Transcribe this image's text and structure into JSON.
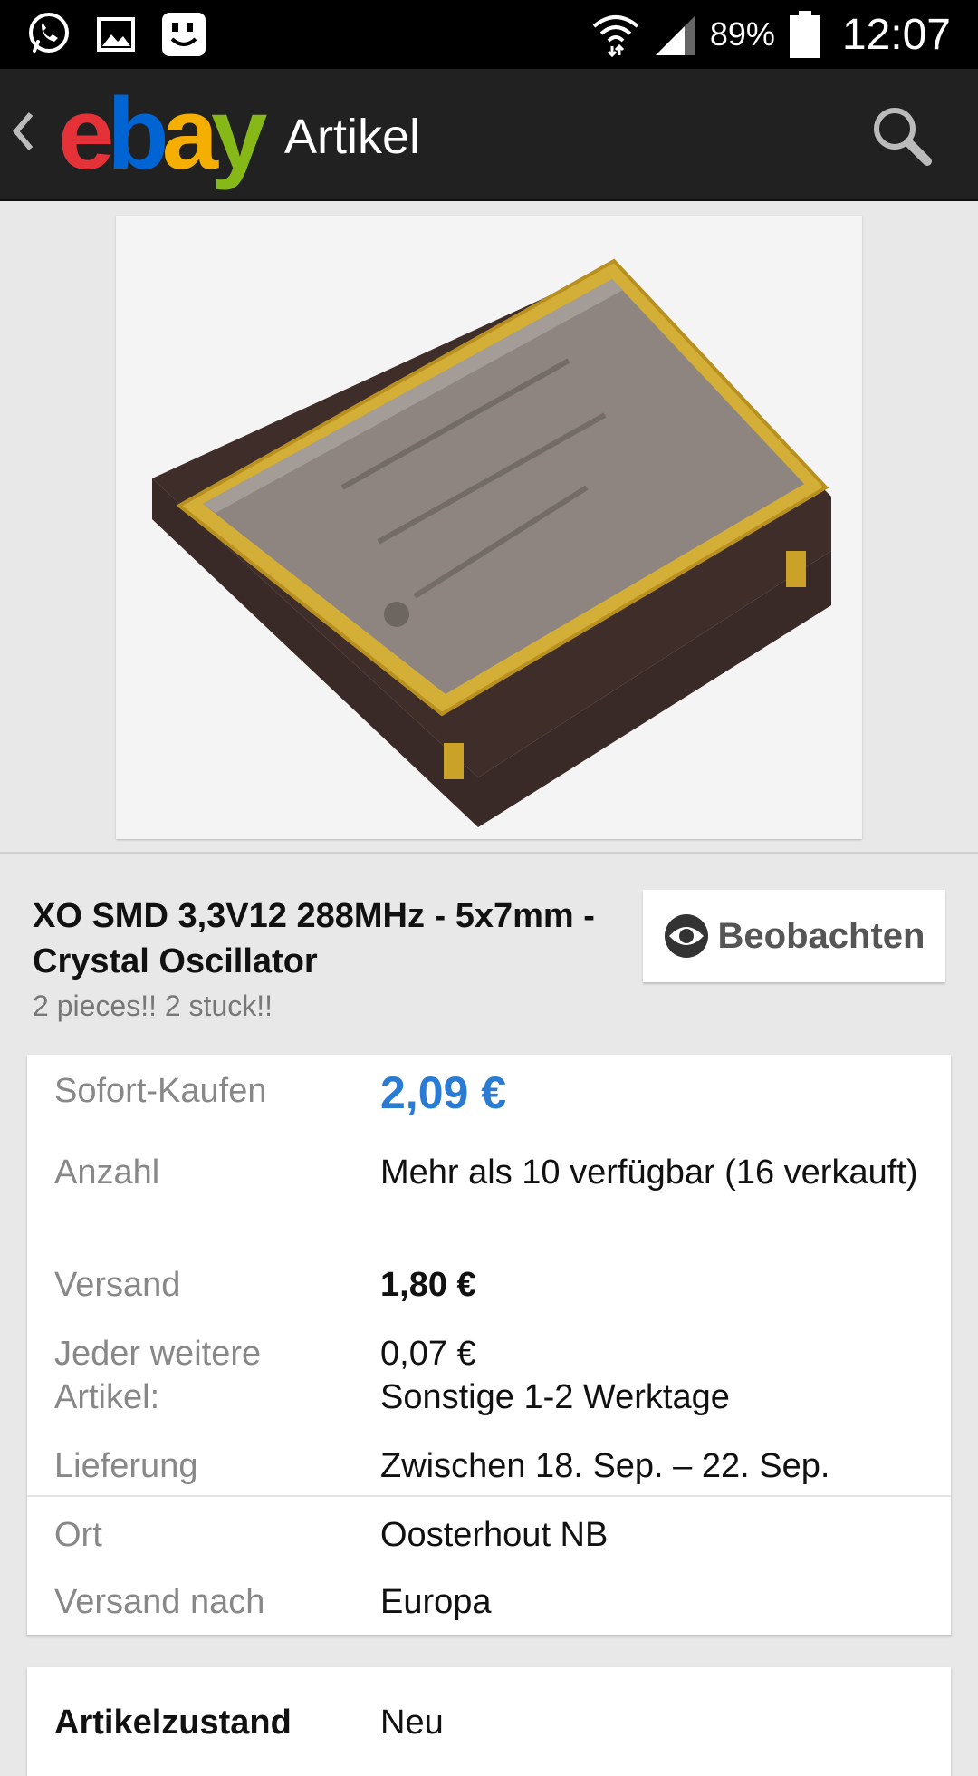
{
  "status_bar": {
    "battery_percent": "89%",
    "time": "12:07",
    "icons": [
      "whatsapp-icon",
      "gallery-icon",
      "messenger-icon",
      "wifi-icon",
      "signal-icon",
      "battery-icon"
    ]
  },
  "app_bar": {
    "logo": {
      "e": "e",
      "b": "b",
      "a": "a",
      "y": "y"
    },
    "title": "Artikel",
    "icons": [
      "back-chevron-icon",
      "search-icon"
    ]
  },
  "product": {
    "title": "XO SMD 3,3V12 288MHz - 5x7mm - Crystal Oscillator",
    "subtitle": "2 pieces!! 2 stuck!!",
    "watch_label": "Beobachten"
  },
  "details": {
    "buy_now_label": "Sofort-Kaufen",
    "buy_now_price": "2,09 €",
    "quantity_label": "Anzahl",
    "quantity_value": "Mehr als 10 verfügbar (16 verkauft)",
    "shipping_label": "Versand",
    "shipping_value": "1,80 €",
    "additional_label": "Jeder weitere Artikel:",
    "additional_value_price": "0,07 €",
    "additional_value_service": "Sonstige 1-2 Werktage",
    "delivery_label": "Lieferung",
    "delivery_value": "Zwischen 18. Sep. – 22. Sep.",
    "location_label": "Ort",
    "location_value": "Oosterhout NB",
    "ships_to_label": "Versand nach",
    "ships_to_value": "Europa"
  },
  "condition": {
    "label": "Artikelzustand",
    "value": "Neu"
  },
  "colors": {
    "price_blue": "#2a7bd4",
    "ebay_red": "#e53238",
    "ebay_blue": "#0064d2",
    "ebay_yellow": "#f5af02",
    "ebay_green": "#86b817"
  }
}
